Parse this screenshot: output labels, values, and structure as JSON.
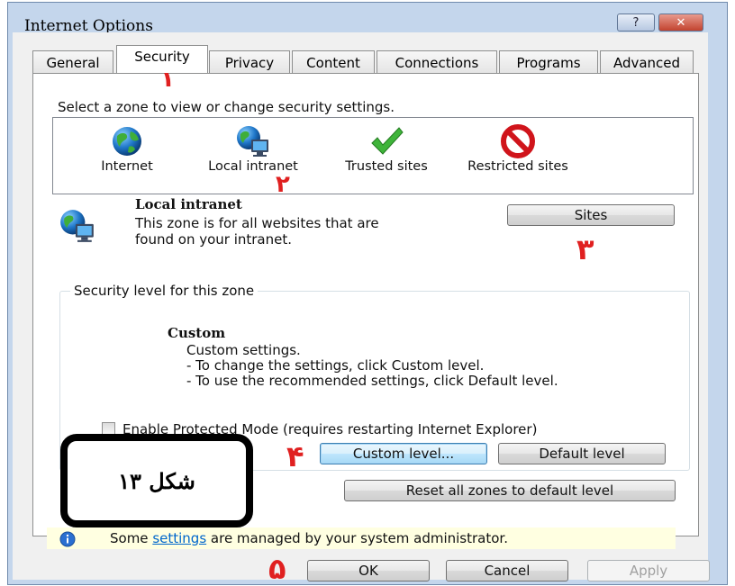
{
  "window": {
    "title": "Internet Options",
    "help_glyph": "?",
    "close_glyph": "✕"
  },
  "tabs": [
    {
      "label": "General"
    },
    {
      "label": "Security"
    },
    {
      "label": "Privacy"
    },
    {
      "label": "Content"
    },
    {
      "label": "Connections"
    },
    {
      "label": "Programs"
    },
    {
      "label": "Advanced"
    }
  ],
  "active_tab": "Security",
  "security": {
    "select_zone_text": "Select a zone to view or change security settings.",
    "zones": [
      {
        "label": "Internet",
        "icon": "globe-icon"
      },
      {
        "label": "Local intranet",
        "icon": "intranet-icon"
      },
      {
        "label": "Trusted sites",
        "icon": "checkmark-icon"
      },
      {
        "label": "Restricted sites",
        "icon": "restricted-icon"
      }
    ],
    "selected_zone": {
      "name": "Local intranet",
      "description_line1": "This zone is for all websites that are",
      "description_line2": "found on your intranet."
    },
    "sites_button": "Sites",
    "level_group_label": "Security level for this zone",
    "level_name": "Custom",
    "level_lines": [
      "Custom settings.",
      "- To change the settings, click Custom level.",
      "- To use the recommended settings, click Default level."
    ],
    "protected_mode_label": "Enable Protected Mode (requires restarting Internet Explorer)",
    "protected_mode_checked": false,
    "custom_level_button": "Custom level...",
    "default_level_button": "Default level",
    "reset_all_button": "Reset all zones to default level",
    "info_prefix": "Some ",
    "info_link": "settings",
    "info_suffix": " are managed by your system administrator."
  },
  "footer": {
    "ok": "OK",
    "cancel": "Cancel",
    "apply": "Apply"
  },
  "annotations": {
    "step1": "١",
    "step2": "٢",
    "step3": "٣",
    "step4": "۴",
    "step5": "۵",
    "figure_label": "شکل ١٣"
  },
  "colors": {
    "annotation_red": "#e02020",
    "info_bar": "#ffffe1",
    "link": "#0066cc"
  }
}
